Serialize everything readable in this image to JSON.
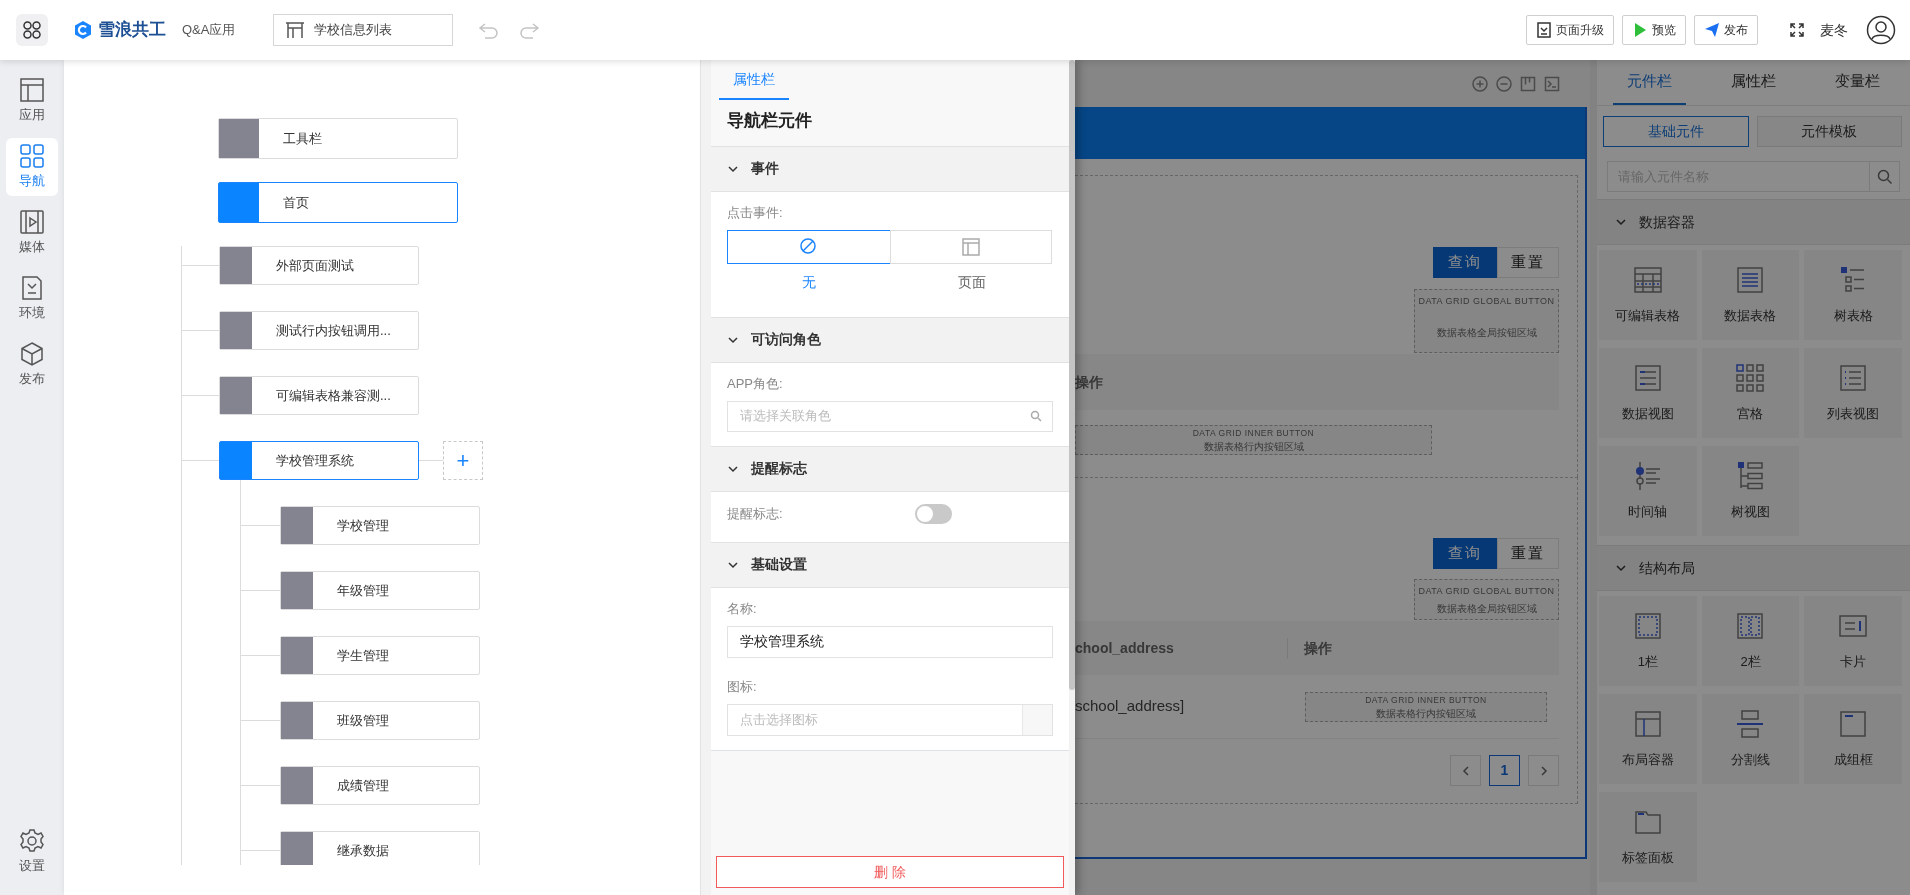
{
  "topbar": {
    "brand": "雪浪共工",
    "app_name": "Q&A应用",
    "page_selector": "学校信息列表",
    "actions": [
      {
        "label": "页面升级",
        "kind": "upgrade"
      },
      {
        "label": "预览",
        "kind": "preview"
      },
      {
        "label": "发布",
        "kind": "publish"
      }
    ],
    "user": "麦冬"
  },
  "nav": {
    "items": [
      {
        "label": "应用",
        "selected": false
      },
      {
        "label": "导航",
        "selected": true
      },
      {
        "label": "媒体",
        "selected": false
      },
      {
        "label": "环境",
        "selected": false
      },
      {
        "label": "发布",
        "selected": false
      }
    ],
    "settings": "设置"
  },
  "tree": {
    "top": [
      {
        "label": "工具栏",
        "selected": false
      },
      {
        "label": "首页",
        "selected": true
      }
    ],
    "branches": [
      {
        "label": "外部页面测试",
        "selected": false
      },
      {
        "label": "测试行内按钮调用...",
        "selected": false
      },
      {
        "label": "可编辑表格兼容测...",
        "selected": false
      },
      {
        "label": "学校管理系统",
        "selected": true,
        "add_button": "+",
        "children": [
          {
            "label": "学校管理",
            "selected": false
          },
          {
            "label": "年级管理",
            "selected": false
          },
          {
            "label": "学生管理",
            "selected": false
          },
          {
            "label": "班级管理",
            "selected": false
          },
          {
            "label": "成绩管理",
            "selected": false
          },
          {
            "label": "继承数据",
            "selected": false
          }
        ]
      }
    ]
  },
  "properties": {
    "tabs": [
      {
        "label": "属性栏",
        "selected": true
      }
    ],
    "title": "导航栏元件",
    "sections": [
      {
        "title": "事件",
        "expanded": true,
        "kind": "event",
        "label": "点击事件:",
        "options": [
          {
            "label": "无",
            "selected": true
          },
          {
            "label": "页面",
            "selected": false
          }
        ]
      },
      {
        "title": "可访问角色",
        "expanded": true,
        "kind": "select",
        "label": "APP角色:",
        "placeholder": "请选择关联角色"
      },
      {
        "title": "提醒标志",
        "expanded": true,
        "kind": "toggle",
        "label": "提醒标志:",
        "on": false
      },
      {
        "title": "基础设置",
        "expanded": true,
        "kind": "basic",
        "name_label": "名称:",
        "name_value": "学校管理系统",
        "icon_label": "图标:",
        "icon_placeholder": "点击选择图标"
      }
    ],
    "delete_button": "删 除"
  },
  "canvas": {
    "sections": [
      {
        "query": "查询",
        "reset": "重置",
        "global_area": [
          "DATA GRID GLOBAL BUTTON",
          "数据表格全局按钮区域"
        ],
        "columns": [
          "操作"
        ],
        "inner_area": [
          "DATA GRID INNER BUTTON",
          "数据表格行内按钮区域"
        ]
      },
      {
        "query": "查询",
        "reset": "重置",
        "global_area": [
          "DATA GRID GLOBAL BUTTON",
          "数据表格全局按钮区域"
        ],
        "columns": [
          "chool_address",
          "操作"
        ],
        "row_cells": [
          "school_address]"
        ],
        "inner_area": [
          "DATA GRID INNER BUTTON",
          "数据表格行内按钮区域"
        ],
        "pages": [
          {
            "label": "1",
            "selected": true
          }
        ]
      }
    ]
  },
  "components": {
    "tabs": [
      {
        "label": "元件栏",
        "selected": true
      },
      {
        "label": "属性栏",
        "selected": false
      },
      {
        "label": "变量栏",
        "selected": false
      }
    ],
    "subtabs": [
      {
        "label": "基础元件",
        "selected": true
      },
      {
        "label": "元件模板",
        "selected": false
      }
    ],
    "search_placeholder": "请输入元件名称",
    "groups": [
      {
        "title": "数据容器",
        "expanded": true,
        "items": [
          "可编辑表格",
          "数据表格",
          "树表格",
          "数据视图",
          "宫格",
          "列表视图",
          "时间轴",
          "树视图"
        ]
      },
      {
        "title": "结构布局",
        "expanded": true,
        "items": [
          "1栏",
          "2栏",
          "卡片",
          "布局容器",
          "分割线",
          "成组框",
          "标签面板"
        ]
      }
    ]
  }
}
